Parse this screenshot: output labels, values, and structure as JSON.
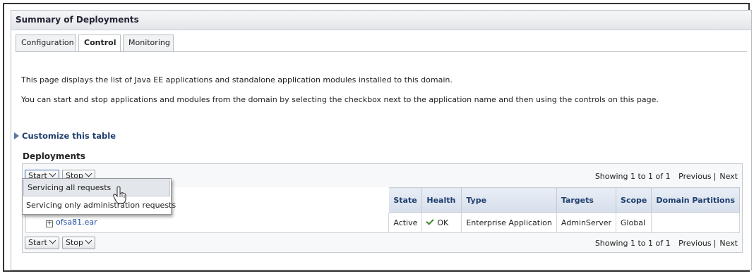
{
  "header": {
    "title": "Summary of Deployments"
  },
  "tabs": [
    {
      "label": "Configuration",
      "active": false
    },
    {
      "label": "Control",
      "active": true
    },
    {
      "label": "Monitoring",
      "active": false
    }
  ],
  "intro": {
    "line1": "This page displays the list of Java EE applications and standalone application modules installed to this domain.",
    "line2": "You can start and stop applications and modules from the domain by selecting the checkbox next to the application name and then using the controls on this page."
  },
  "customize": {
    "label": "Customize this table"
  },
  "deployments": {
    "title": "Deployments",
    "start_label": "Start",
    "stop_label": "Stop",
    "paging": {
      "showing": "Showing 1 to 1 of 1",
      "previous": "Previous",
      "next": "Next"
    },
    "columns": [
      "State",
      "Health",
      "Type",
      "Targets",
      "Scope",
      "Domain Partitions"
    ],
    "rows": [
      {
        "name": "ofsa81.ear",
        "state": "Active",
        "health": "OK",
        "type": "Enterprise Application",
        "targets": "AdminServer",
        "scope": "Global",
        "partitions": ""
      }
    ]
  },
  "start_menu": {
    "items": [
      "Servicing all requests",
      "Servicing only administration requests"
    ],
    "hovered_index": 0
  },
  "colors": {
    "header_text": "#1f3f6e",
    "link": "#1f4fa0",
    "ok": "#3a8a2a"
  }
}
